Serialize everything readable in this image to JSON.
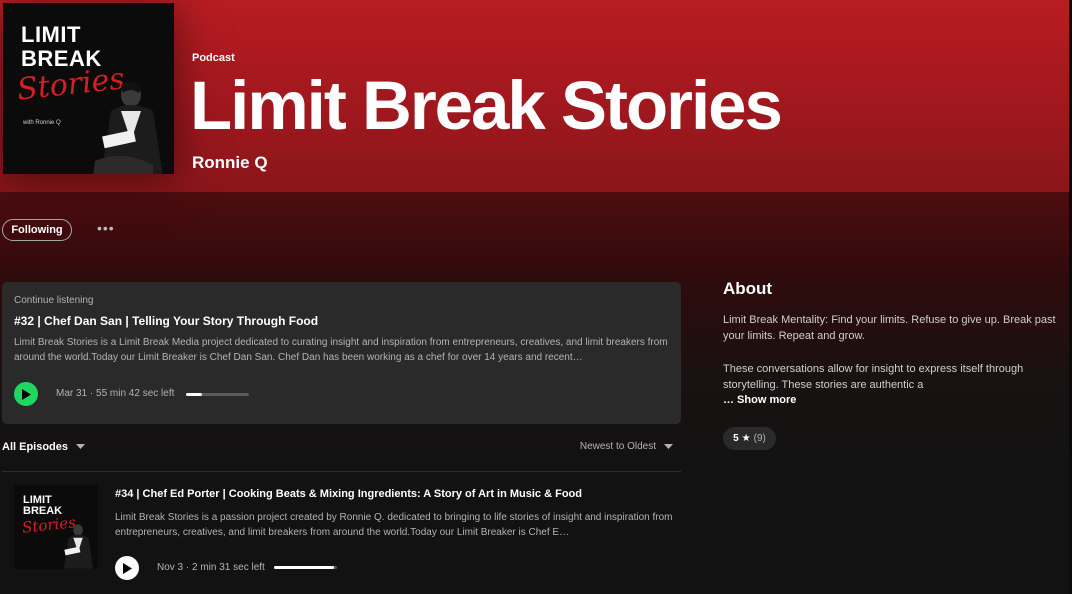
{
  "podcast": {
    "type_label": "Podcast",
    "title": "Limit Break Stories",
    "author": "Ronnie Q",
    "cover": {
      "line1": "LIMIT",
      "line2": "BREAK",
      "script": "Stories",
      "byline": "with Ronnie Q"
    }
  },
  "actions": {
    "follow_label": "Following",
    "more_label": "•••"
  },
  "continue_listening": {
    "label": "Continue listening",
    "title": "#32 | Chef Dan San | Telling Your Story Through Food",
    "description": "Limit Break Stories is a Limit Break Media project dedicated to curating insight and inspiration from entrepreneurs, creatives, and limit breakers from around the world.Today our Limit Breaker is Chef Dan San. Chef Dan has been working as a chef for over 14 years and recent…",
    "meta": "Mar 31 · 55 min 42 sec left",
    "progress": 0.25
  },
  "episodes_header": {
    "filter_label": "All Episodes",
    "sort_label": "Newest to Oldest"
  },
  "episodes": [
    {
      "title": "#34 | Chef Ed Porter | Cooking Beats & Mixing Ingredients: A Story of Art in Music & Food",
      "description": "Limit Break Stories is a passion project created by Ronnie Q. dedicated to bringing to life stories of insight and inspiration from entrepreneurs, creatives, and limit breakers from around the world.Today our Limit Breaker is Chef E…",
      "meta": "Nov 3 · 2 min 31 sec left",
      "progress": 0.95,
      "art": {
        "line1": "LIMIT",
        "line2": "BREAK",
        "script": "Stories"
      }
    }
  ],
  "about": {
    "heading": "About",
    "paragraph1": "Limit Break Mentality: Find your limits. Refuse to give up. Break past your limits. Repeat and grow.",
    "paragraph2": "These conversations allow for insight to express itself through storytelling. These stories are authentic a",
    "show_more": "… Show more",
    "rating_value": "5",
    "rating_count": "(9)"
  },
  "colors": {
    "header_red": "#b81c22",
    "play_green": "#1ed760"
  }
}
